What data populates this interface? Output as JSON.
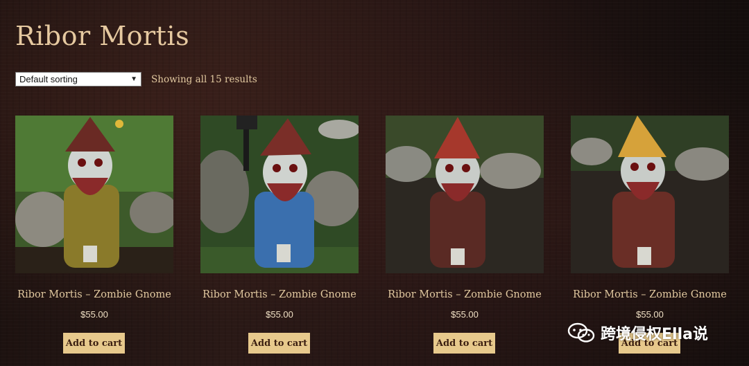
{
  "page": {
    "title": "Ribor Mortis",
    "sorting": {
      "selected": "Default sorting"
    },
    "result_count": "Showing all 15 results"
  },
  "products": [
    {
      "name": "Ribor Mortis – Zombie Gnome",
      "price": "$55.00",
      "button": "Add to cart",
      "hat_color": "#6a2a24",
      "body_color": "#8a7a2a"
    },
    {
      "name": "Ribor Mortis – Zombie Gnome",
      "price": "$55.00",
      "button": "Add to cart",
      "hat_color": "#7a2e28",
      "body_color": "#3a6fae"
    },
    {
      "name": "Ribor Mortis – Zombie Gnome",
      "price": "$55.00",
      "button": "Add to cart",
      "hat_color": "#a6382c",
      "body_color": "#5a2a24"
    },
    {
      "name": "Ribor Mortis – Zombie Gnome",
      "price": "$55.00",
      "button": "Add to cart",
      "hat_color": "#d6a23a",
      "body_color": "#6a2e26"
    }
  ],
  "watermark": {
    "text": "跨境侵权Ella说",
    "icon": "wechat-icon"
  }
}
